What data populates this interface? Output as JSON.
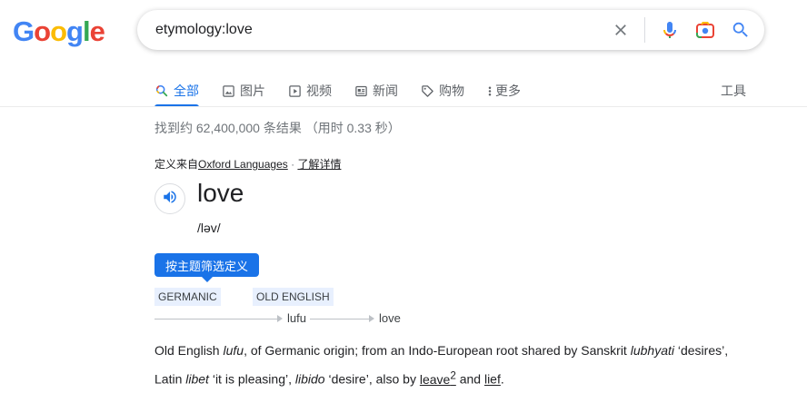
{
  "logo": {
    "letters": [
      "G",
      "o",
      "o",
      "g",
      "l",
      "e"
    ],
    "colors": [
      "#4285F4",
      "#EA4335",
      "#FBBC05",
      "#4285F4",
      "#34A853",
      "#EA4335"
    ]
  },
  "search": {
    "query": "etymology:love"
  },
  "tabs": [
    {
      "label": "全部",
      "icon": "search-icon"
    },
    {
      "label": "图片",
      "icon": "image-icon"
    },
    {
      "label": "视频",
      "icon": "video-icon"
    },
    {
      "label": "新闻",
      "icon": "news-icon"
    },
    {
      "label": "购物",
      "icon": "tag-icon"
    },
    {
      "label": "更多",
      "icon": "more-vert-icon"
    }
  ],
  "tools_label": "工具",
  "result_stats": "找到约 62,400,000 条结果 （用时 0.33 秒）",
  "dictionary": {
    "source_prefix": "定义来自",
    "source_name": "Oxford Languages",
    "source_sep": " · ",
    "learn_more": "了解详情",
    "word": "love",
    "phonetic": "/ləv/",
    "filter_button": "按主题筛选定义",
    "etymology_chart": {
      "languages": [
        "GERMANIC",
        "OLD ENGLISH"
      ],
      "forms": [
        "lufu",
        "love"
      ]
    },
    "etymology_text": {
      "p1": "Old English ",
      "i1": "lufu",
      "p2": ", of Germanic origin; from an Indo-European root shared by Sanskrit ",
      "i2": "lubhyati",
      "p3": " ‘desires’, Latin ",
      "i3": "libet",
      "p4": " ‘it is pleasing’, ",
      "i4": "libido",
      "p5": " ‘desire’, also by ",
      "link1": "leave",
      "sup1": "2",
      "p6": " and ",
      "link2": "lief",
      "p7": "."
    }
  },
  "colors": {
    "accent": "#1a73e8",
    "tag_bg": "#e8f0fe"
  }
}
